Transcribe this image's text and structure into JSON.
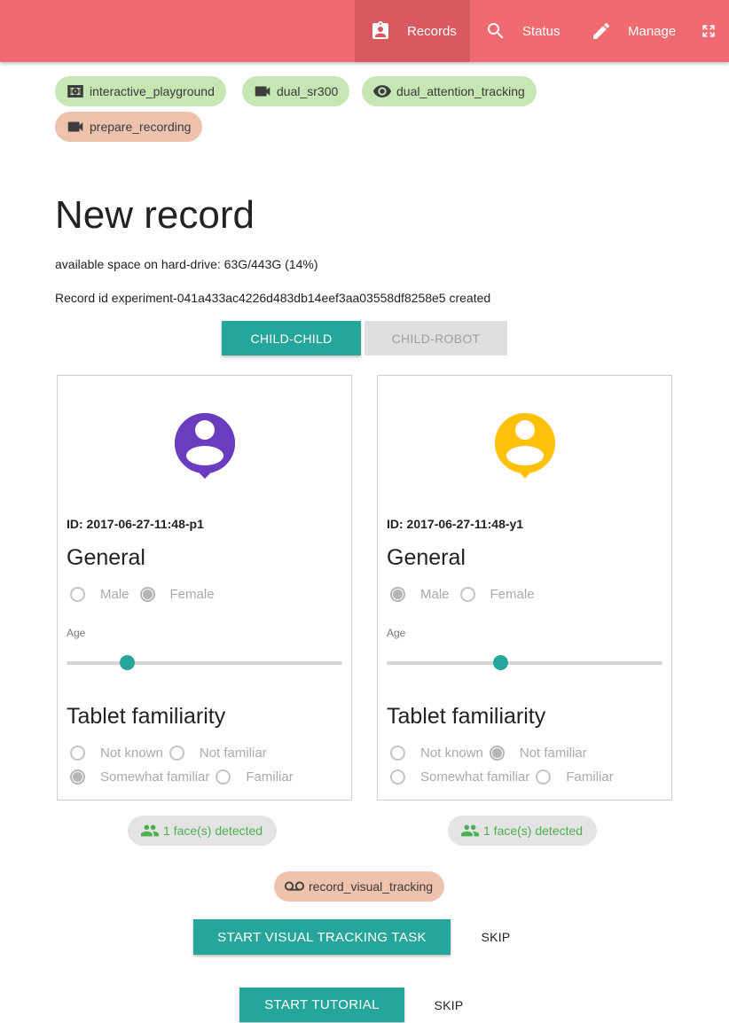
{
  "nav": {
    "records_label": "Records",
    "status_label": "Status",
    "manage_label": "Manage",
    "records_icon": "assignment-ind-icon",
    "status_icon": "search-icon",
    "manage_icon": "pencil-icon",
    "fullscreen_icon": "fullscreen-icon"
  },
  "chips": [
    {
      "label": "interactive_playground",
      "icon": "radio-icon",
      "color": "#c6e6b3"
    },
    {
      "label": "dual_sr300",
      "icon": "videocam-icon",
      "color": "#c6e6b3"
    },
    {
      "label": "dual_attention_tracking",
      "icon": "eye-icon",
      "color": "#c6e6b3"
    },
    {
      "label": "prepare_recording",
      "icon": "videocam-icon",
      "color": "#eec2ad"
    }
  ],
  "page": {
    "title": "New record",
    "disk_space": "available space on hard-drive: 63G/443G (14%)",
    "record_id": "Record id experiment-041a433ac4226d483db14eef3aa03558df8258e5 created"
  },
  "mode_toggle": {
    "child_child": "CHILD-CHILD",
    "child_robot": "CHILD-ROBOT",
    "selected": "CHILD-CHILD"
  },
  "participants": [
    {
      "id_text": "ID: 2017-06-27-11:48-p1",
      "avatar_color": "#6a3cc0",
      "general": "General",
      "male": "Male",
      "female": "Female",
      "gender": "Female",
      "age_label": "Age",
      "age_fraction": 0.22,
      "tablet": "Tablet familiarity",
      "not_known": "Not known",
      "not_familiar": "Not familiar",
      "somewhat": "Somewhat familiar",
      "familiar": "Familiar",
      "familiarity": "Somewhat familiar",
      "faces": "1 face(s) detected"
    },
    {
      "id_text": "ID: 2017-06-27-11:48-y1",
      "avatar_color": "#ffc107",
      "general": "General",
      "male": "Male",
      "female": "Female",
      "gender": "Male",
      "age_label": "Age",
      "age_fraction": 0.41,
      "tablet": "Tablet familiarity",
      "not_known": "Not known",
      "not_familiar": "Not familiar",
      "somewhat": "Somewhat familiar",
      "familiar": "Familiar",
      "familiarity": "Not familiar",
      "faces": "1 face(s) detected"
    }
  ],
  "visual_tracking": {
    "chip_label": "record_visual_tracking",
    "chip_icon": "voicemail-icon",
    "start_label": "START VISUAL TRACKING TASK",
    "skip_label": "SKIP"
  },
  "tutorial": {
    "start_label": "START TUTORIAL",
    "skip_label": "SKIP"
  }
}
